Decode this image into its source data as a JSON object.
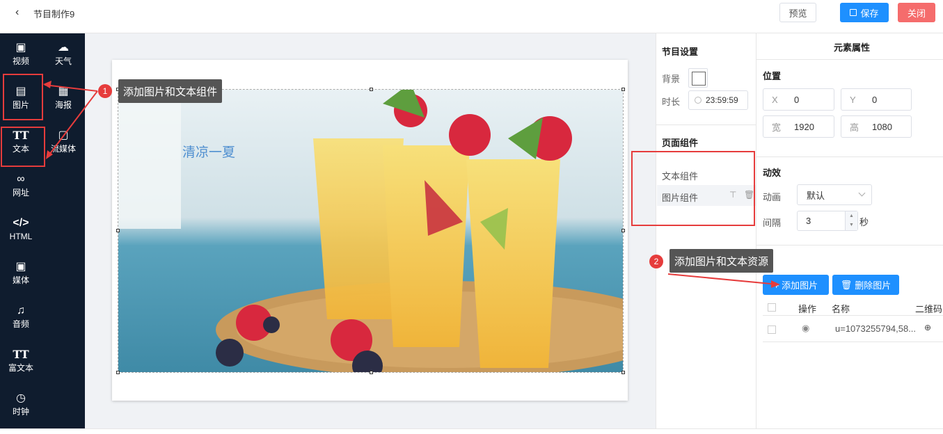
{
  "topbar": {
    "title": "节目制作9",
    "preview": "预览",
    "save": "保存",
    "close": "关闭"
  },
  "sidebar": {
    "tools": [
      {
        "label": "视频",
        "icon": "video-icon"
      },
      {
        "label": "天气",
        "icon": "cloud-icon"
      },
      {
        "label": "图片",
        "icon": "image-icon"
      },
      {
        "label": "海报",
        "icon": "poster-icon"
      },
      {
        "label": "文本",
        "icon": "text-icon"
      },
      {
        "label": "流媒体",
        "icon": "stream-icon"
      },
      {
        "label": "网址",
        "icon": "link-icon"
      },
      {
        "label": "HTML",
        "icon": "code-icon"
      },
      {
        "label": "媒体",
        "icon": "media-icon"
      },
      {
        "label": "音频",
        "icon": "music-icon"
      },
      {
        "label": "富文本",
        "icon": "richtext-icon"
      },
      {
        "label": "时钟",
        "icon": "clock-icon"
      }
    ]
  },
  "canvas": {
    "overlay_text": "清凉一夏"
  },
  "program_settings": {
    "title": "节目设置",
    "bg_label": "背景",
    "duration_label": "时长",
    "duration": "23:59:59"
  },
  "page_components": {
    "title": "页面组件",
    "items": [
      "文本组件",
      "图片组件"
    ]
  },
  "element_props": {
    "title": "元素属性",
    "position_title": "位置",
    "x_label": "X",
    "x": "0",
    "y_label": "Y",
    "y": "0",
    "w_label": "宽",
    "w": "1920",
    "h_label": "高",
    "h": "1080",
    "effect_title": "动效",
    "anim_label": "动画",
    "anim_value": "默认",
    "interval_label": "间隔",
    "interval_value": "3",
    "interval_unit": "秒",
    "add_image": "+ 添加图片",
    "delete_image": "删除图片",
    "table": {
      "col_action": "操作",
      "col_name": "名称",
      "col_qr": "二维码",
      "row_name": "u=1073255794,58..."
    }
  },
  "annotations": {
    "callout1": "添加图片和文本组件",
    "callout2": "添加图片和文本资源",
    "badge1": "1",
    "badge2": "2"
  }
}
